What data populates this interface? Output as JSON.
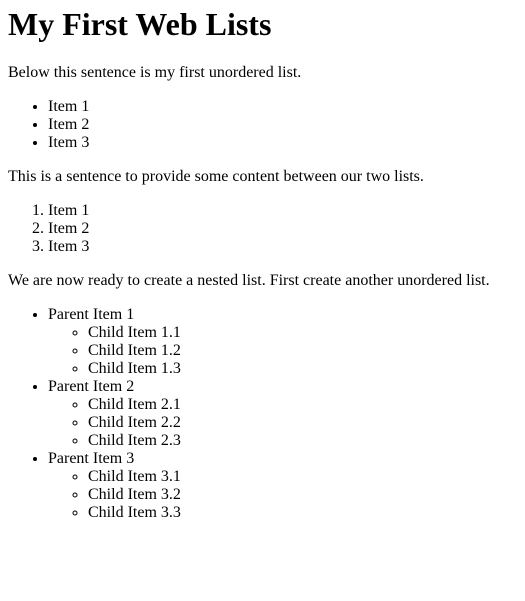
{
  "page": {
    "title": "My First Web Lists",
    "intro": "Below this sentence is my first unordered list.",
    "unordered_list": [
      "Item 1",
      "Item 2",
      "Item 3"
    ],
    "between": "This is a sentence to provide some content between our two lists.",
    "ordered_list": [
      "Item 1",
      "Item 2",
      "Item 3"
    ],
    "nested_intro": "We are now ready to create a nested list. First create another unordered list.",
    "nested_list": [
      {
        "label": "Parent Item 1",
        "children": [
          "Child Item 1.1",
          "Child Item 1.2",
          "Child Item 1.3"
        ]
      },
      {
        "label": "Parent Item 2",
        "children": [
          "Child Item 2.1",
          "Child Item 2.2",
          "Child Item 2.3"
        ]
      },
      {
        "label": "Parent Item 3",
        "children": [
          "Child Item 3.1",
          "Child Item 3.2",
          "Child Item 3.3"
        ]
      }
    ]
  }
}
